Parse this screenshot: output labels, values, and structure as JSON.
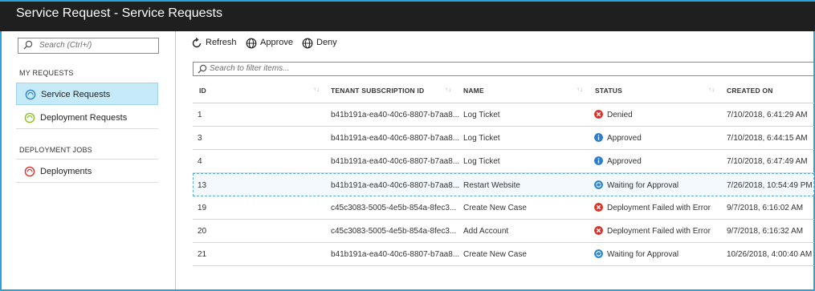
{
  "window": {
    "title": "Service Request - Service Requests"
  },
  "sidebar": {
    "search_placeholder": "Search (Ctrl+/)",
    "sections": [
      {
        "header": "MY REQUESTS",
        "items": [
          {
            "label": "Service Requests",
            "icon": "service-requests-icon",
            "selected": true
          },
          {
            "label": "Deployment Requests",
            "icon": "deployment-requests-icon",
            "selected": false
          }
        ]
      },
      {
        "header": "DEPLOYMENT JOBS",
        "items": [
          {
            "label": "Deployments",
            "icon": "deployments-icon",
            "selected": false
          }
        ]
      }
    ]
  },
  "toolbar": {
    "refresh_label": "Refresh",
    "approve_label": "Approve",
    "deny_label": "Deny"
  },
  "filter": {
    "placeholder": "Search to filter items..."
  },
  "table": {
    "columns": [
      "ID",
      "TENANT SUBSCRIPTION ID",
      "NAME",
      "STATUS",
      "CREATED ON"
    ],
    "rows": [
      {
        "id": "1",
        "tenant": "b41b191a-ea40-40c6-8807-b7aa8...",
        "name": "Log Ticket",
        "status": "Denied",
        "status_type": "error",
        "created": "7/10/2018, 6:41:29 AM"
      },
      {
        "id": "3",
        "tenant": "b41b191a-ea40-40c6-8807-b7aa8...",
        "name": "Log Ticket",
        "status": "Approved",
        "status_type": "info",
        "created": "7/10/2018, 6:44:15 AM"
      },
      {
        "id": "4",
        "tenant": "b41b191a-ea40-40c6-8807-b7aa8...",
        "name": "Log Ticket",
        "status": "Approved",
        "status_type": "info",
        "created": "7/10/2018, 6:47:49 AM"
      },
      {
        "id": "13",
        "tenant": "b41b191a-ea40-40c6-8807-b7aa8...",
        "name": "Restart Website",
        "status": "Waiting for Approval",
        "status_type": "waiting",
        "created": "7/26/2018, 10:54:49 PM"
      },
      {
        "id": "19",
        "tenant": "c45c3083-5005-4e5b-854a-8fec3...",
        "name": "Create New Case",
        "status": "Deployment Failed with Error",
        "status_type": "error",
        "created": "9/7/2018, 6:16:02 AM"
      },
      {
        "id": "20",
        "tenant": "c45c3083-5005-4e5b-854a-8fec3...",
        "name": "Add Account",
        "status": "Deployment Failed with Error",
        "status_type": "error",
        "created": "9/7/2018, 6:16:32 AM"
      },
      {
        "id": "21",
        "tenant": "b41b191a-ea40-40c6-8807-b7aa8...",
        "name": "Create New Case",
        "status": "Waiting for Approval",
        "status_type": "waiting",
        "created": "10/26/2018, 4:00:40 AM"
      }
    ]
  },
  "colors": {
    "accent": "#2aa3d8",
    "error": "#d9342b",
    "info": "#2f7cc9",
    "waiting": "#2f86c9",
    "selected_bg": "#c7eaf8"
  }
}
